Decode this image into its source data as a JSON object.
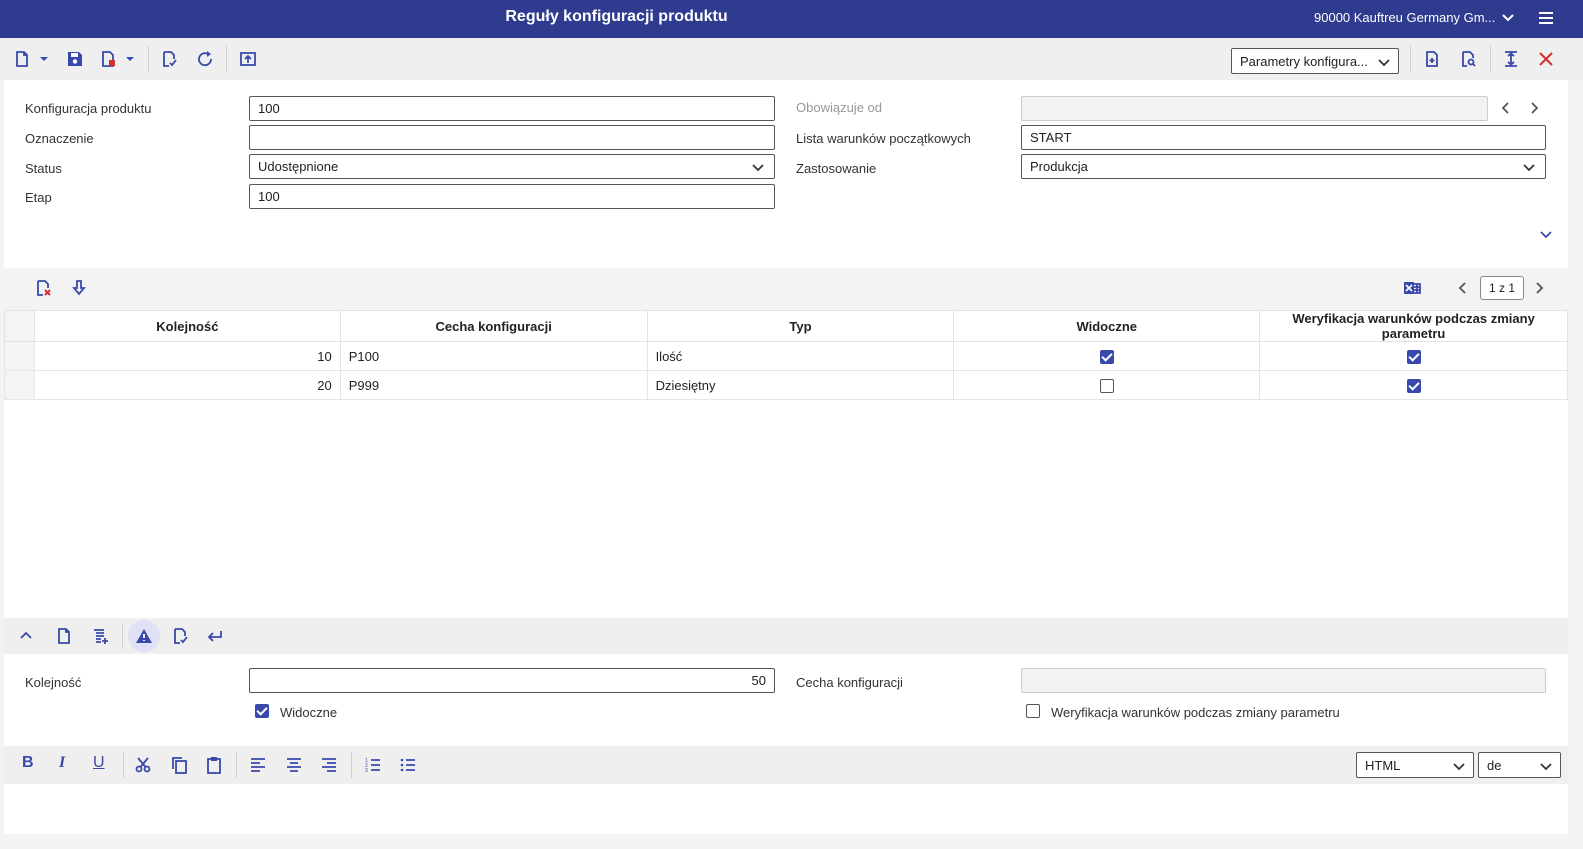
{
  "app": {
    "title": "Reguły konfiguracji produktu",
    "company": "90000  Kauftreu Germany Gm..."
  },
  "toolbar": {
    "view_select": "Parametry konfigura..."
  },
  "header": {
    "konfiguracja_label": "Konfiguracja produktu",
    "konfiguracja_value": "100",
    "oznaczenie_label": "Oznaczenie",
    "oznaczenie_value": "",
    "status_label": "Status",
    "status_value": "Udostępnione",
    "etap_label": "Etap",
    "etap_value": "100",
    "obowiazuje_label": "Obowiązuje od",
    "obowiazuje_value": "",
    "lista_label": "Lista warunków początkowych",
    "lista_value": "START",
    "zastosowanie_label": "Zastosowanie",
    "zastosowanie_value": "Produkcja"
  },
  "grid": {
    "pager": "1 z 1",
    "columns": [
      "Kolejność",
      "Cecha konfiguracji",
      "Typ",
      "Widoczne",
      "Weryfikacja warunków podczas zmiany parametru"
    ],
    "rows": [
      {
        "kolejnosc": "10",
        "cecha": "P100",
        "typ": "Ilość",
        "widoczne": true,
        "weryfikacja": true
      },
      {
        "kolejnosc": "20",
        "cecha": "P999",
        "typ": "Dziesiętny",
        "widoczne": false,
        "weryfikacja": true
      }
    ]
  },
  "detail": {
    "kolejnosc_label": "Kolejność",
    "kolejnosc_value": "50",
    "cecha_label": "Cecha konfiguracji",
    "cecha_value": "",
    "widoczne_label": "Widoczne",
    "widoczne_checked": true,
    "weryfikacja_label": "Weryfikacja warunków podczas zmiany parametru",
    "weryfikacja_checked": false
  },
  "editor": {
    "format_select": "HTML",
    "lang_select": "de",
    "bold_label": "B",
    "italic_label": "I",
    "underline_label": "U"
  }
}
